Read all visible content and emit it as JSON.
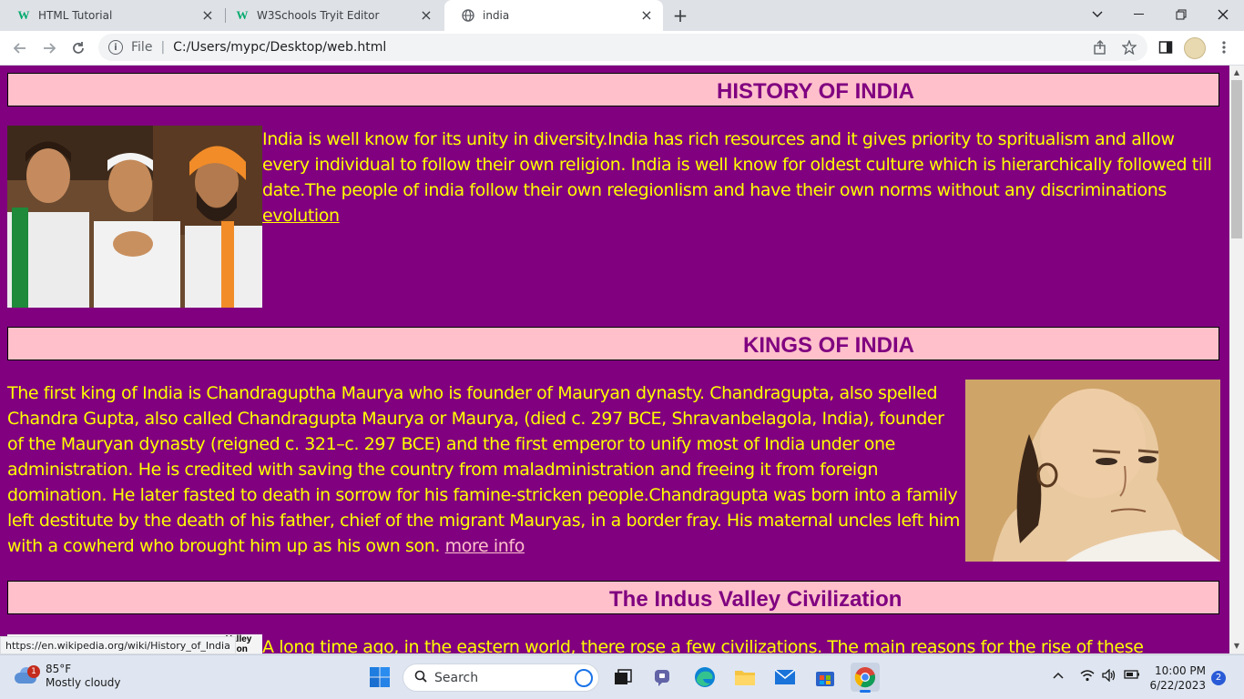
{
  "browser": {
    "tabs": [
      {
        "title": "HTML Tutorial",
        "favicon": "w3schools-icon",
        "active": false
      },
      {
        "title": "W3Schools Tryit Editor",
        "favicon": "w3schools-icon",
        "active": false
      },
      {
        "title": "india",
        "favicon": "globe-icon",
        "active": true
      }
    ],
    "favicon_glyph": "W",
    "address": {
      "scheme": "File",
      "url": "C:/Users/mypc/Desktop/web.html"
    },
    "status_url": "https://en.wikipedia.org/wiki/History_of_India"
  },
  "page": {
    "background": "#800080",
    "heading_bg": "#ffc0cb",
    "text_color": "#ffff00",
    "sections": [
      {
        "heading": "HISTORY OF INDIA",
        "image_alt": "Three smiling men embracing",
        "text": "India is well know for its unity in diversity.India has rich resources and it gives priority to spritualism and allow every individual to follow their own religion. India is well know for oldest culture which is hierarchically followed till date.The people of india follow their own relegionlism and have their own norms without any discriminations ",
        "link": "evolution"
      },
      {
        "heading": "KINGS OF INDIA",
        "image_alt": "Painting of Chanakya",
        "text": "The first king of India is Chandraguptha Maurya who is founder of Mauryan dynasty. Chandragupta, also spelled Chandra Gupta, also called Chandragupta Maurya or Maurya, (died c. 297 BCE, Shravanbelagola, India), founder of the Mauryan dynasty (reigned c. 321–c. 297 BCE) and the first emperor to unify most of India under one administration. He is credited with saving the country from maladministration and freeing it from foreign domination. He later fasted to death in sorrow for his famine-stricken people.Chandragupta was born into a family left destitute by the death of his father, chief of the migrant Mauryas, in a border fray. His maternal uncles left him with a cowherd who brought him up as his own son. ",
        "link": "more info"
      },
      {
        "heading": "The Indus Valley Civilization",
        "image_text": "Valley\nation",
        "text": "A long time ago, in the eastern world, there rose a few civilizations. The main reasons for the rise of these"
      }
    ]
  },
  "taskbar": {
    "weather": {
      "temp": "85°F",
      "desc": "Mostly cloudy",
      "badge": "1"
    },
    "search_placeholder": "Search",
    "clock": {
      "time": "10:00 PM",
      "date": "6/22/2023"
    },
    "notifications": "2"
  }
}
